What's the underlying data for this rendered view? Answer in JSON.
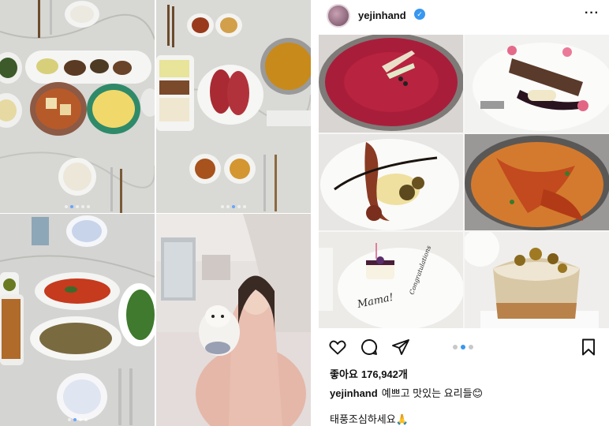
{
  "post": {
    "username": "yejinhand",
    "verified": true,
    "likes_label": "좋아요",
    "likes_count": "176,942개",
    "caption_user": "yejinhand",
    "caption_text": "예쁘고 맛있는 요리들😊",
    "caption_line2": "태풍조심하세요🙏",
    "carousel_total": 3,
    "carousel_active": 2
  },
  "photo_labels": {
    "plate_inscription": "Mama!",
    "plate_inscription_2": "Congratulations"
  },
  "colors": {
    "verified_blue": "#3897f0",
    "carousel_active": "#3897f0"
  },
  "icons": [
    "heart-icon",
    "comment-icon",
    "share-icon",
    "bookmark-icon",
    "more-icon",
    "verified-icon"
  ]
}
